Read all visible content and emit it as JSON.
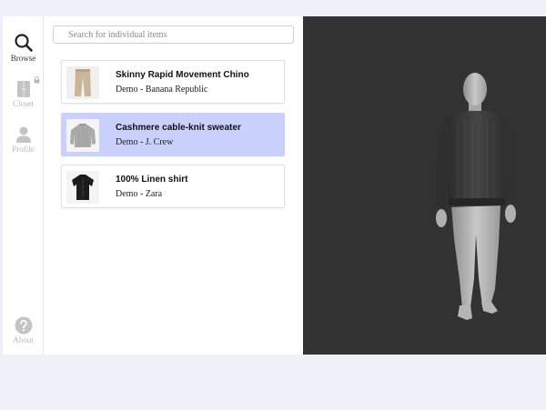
{
  "sidebar": {
    "items": [
      {
        "label": "Browse",
        "icon": "search-icon",
        "active": true
      },
      {
        "label": "Closet",
        "icon": "closet-icon",
        "locked": true
      },
      {
        "label": "Profile",
        "icon": "person-icon"
      },
      {
        "label": "About",
        "icon": "question-icon"
      }
    ]
  },
  "search": {
    "placeholder": "Search for individual items",
    "value": ""
  },
  "items": [
    {
      "name": "Skinny Rapid Movement Chino",
      "brand": "Demo - Banana Republic",
      "thumbnail": "chino-pants",
      "selected": false
    },
    {
      "name": "Cashmere cable-knit sweater",
      "brand": "Demo - J. Crew",
      "thumbnail": "grey-sweater",
      "selected": true
    },
    {
      "name": "100% Linen shirt",
      "brand": "Demo - Zara",
      "thumbnail": "black-shirt",
      "selected": false
    }
  ],
  "colors": {
    "page_background": "#eef2f8",
    "selected_card": "#c9d0fb",
    "viewer_background": "#323232",
    "disabled_nav": "#b8b8b8"
  }
}
